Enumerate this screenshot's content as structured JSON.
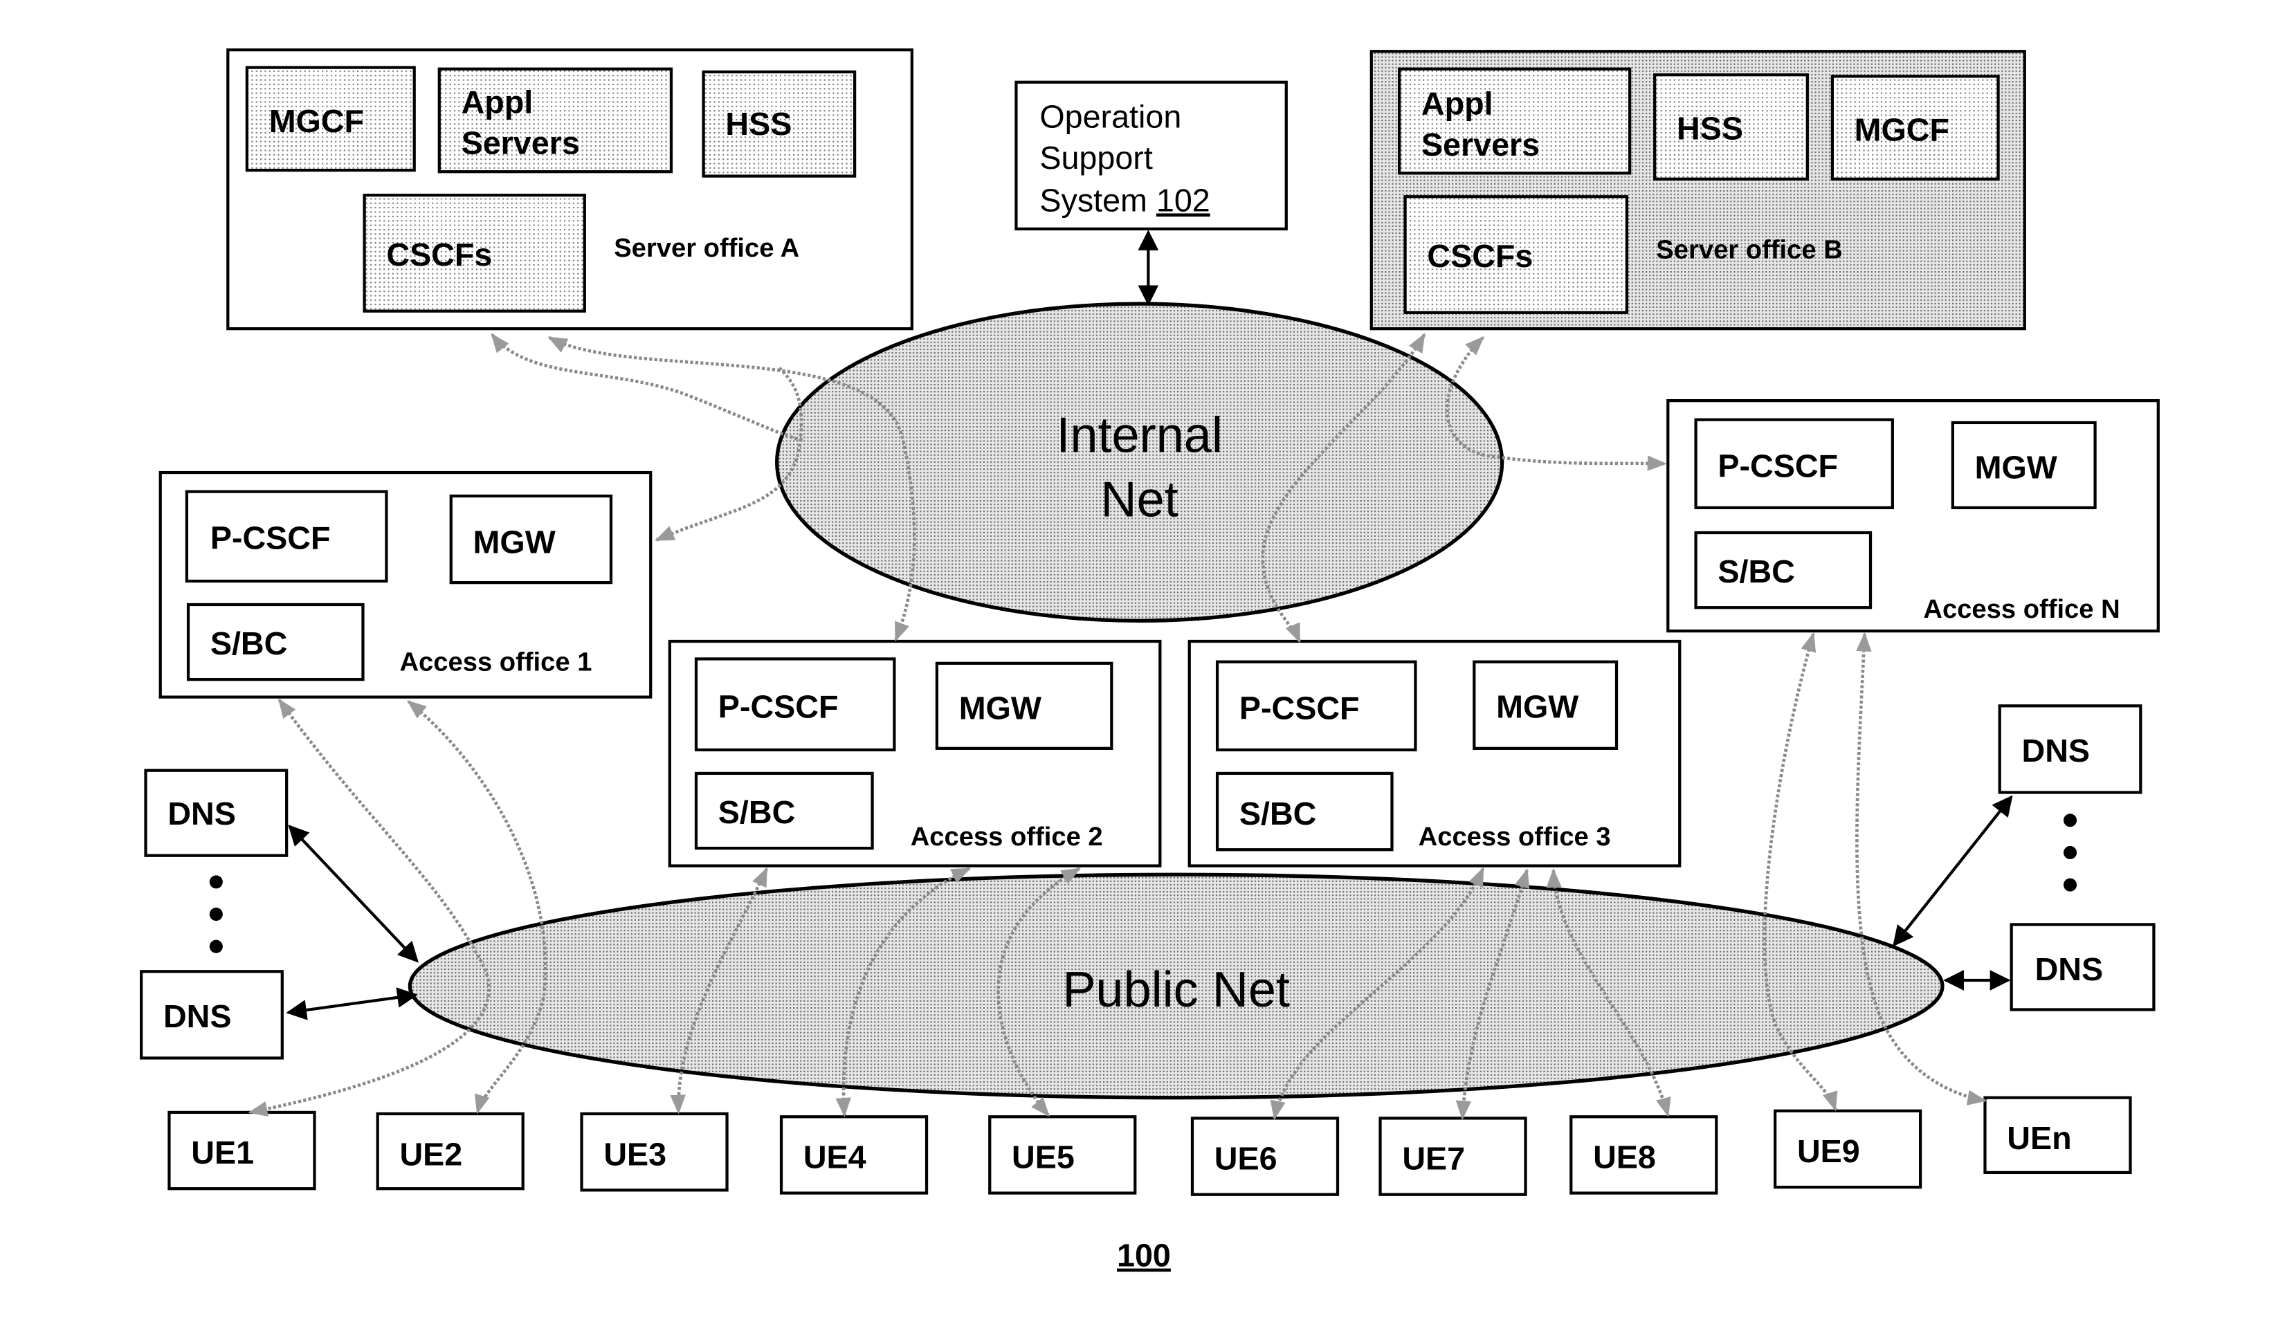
{
  "figure_number": "100",
  "server_office_a": {
    "label": "Server office A",
    "components": {
      "mgcf": "MGCF",
      "appl_line1": "Appl",
      "appl_line2": "Servers",
      "hss": "HSS",
      "cscfs": "CSCFs"
    }
  },
  "server_office_b": {
    "label": "Server office B",
    "components": {
      "appl_line1": "Appl",
      "appl_line2": "Servers",
      "hss": "HSS",
      "mgcf": "MGCF",
      "cscfs": "CSCFs"
    }
  },
  "oss": {
    "line1": "Operation",
    "line2": "Support",
    "line3_prefix": "System ",
    "ref": "102"
  },
  "internal_net": {
    "line1": "Internal",
    "line2": "Net"
  },
  "public_net": {
    "label": "Public Net"
  },
  "access_offices": [
    {
      "label": "Access office 1",
      "pcscf": "P-CSCF",
      "mgw": "MGW",
      "sbc": "S/BC"
    },
    {
      "label": "Access office 2",
      "pcscf": "P-CSCF",
      "mgw": "MGW",
      "sbc": "S/BC"
    },
    {
      "label": "Access office 3",
      "pcscf": "P-CSCF",
      "mgw": "MGW",
      "sbc": "S/BC"
    },
    {
      "label": "Access office N",
      "pcscf": "P-CSCF",
      "mgw": "MGW",
      "sbc": "S/BC"
    }
  ],
  "dns": {
    "left_top": "DNS",
    "left_bottom": "DNS",
    "right_top": "DNS",
    "right_bottom": "DNS"
  },
  "ues": [
    "UE1",
    "UE2",
    "UE3",
    "UE4",
    "UE5",
    "UE6",
    "UE7",
    "UE8",
    "UE9",
    "UEn"
  ]
}
